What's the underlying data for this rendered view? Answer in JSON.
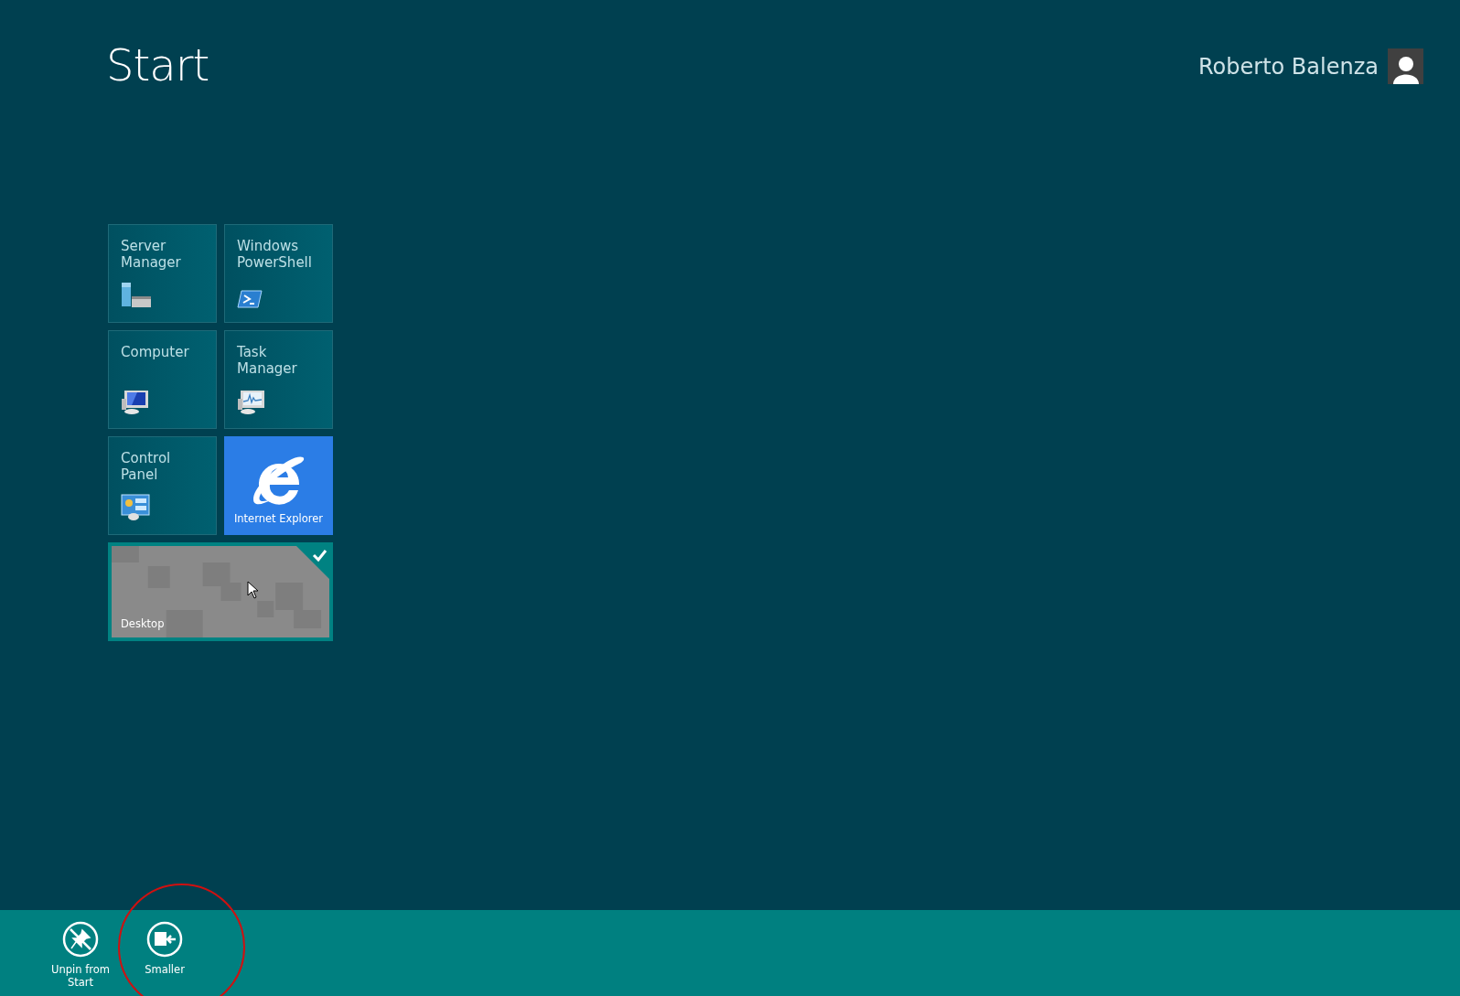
{
  "header": {
    "title": "Start",
    "user_name": "Roberto Balenza"
  },
  "tiles": [
    {
      "kind": "text",
      "label": "Server Manager",
      "selected": false
    },
    {
      "kind": "text",
      "label": "Windows PowerShell",
      "selected": false
    },
    {
      "kind": "text",
      "label": "Computer",
      "selected": false
    },
    {
      "kind": "text",
      "label": "Task Manager",
      "selected": false
    },
    {
      "kind": "text",
      "label": "Control Panel",
      "selected": false
    },
    {
      "kind": "logo",
      "label": "Internet Explorer",
      "selected": false
    },
    {
      "kind": "preview",
      "label": "Desktop",
      "selected": true
    }
  ],
  "app_bar": {
    "commands": [
      {
        "label": "Unpin from Start",
        "highlighted": false
      },
      {
        "label": "Smaller",
        "highlighted": true
      }
    ]
  }
}
